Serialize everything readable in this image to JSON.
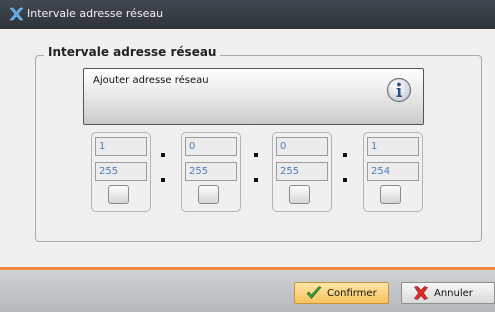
{
  "window": {
    "title": "Intervale adresse réseau",
    "icon": "app-x-icon"
  },
  "group": {
    "legend": "Intervale adresse réseau"
  },
  "info": {
    "text": "Ajouter adresse réseau",
    "icon": "info-icon"
  },
  "octets": [
    {
      "start": "1",
      "end": "255"
    },
    {
      "start": "0",
      "end": "255"
    },
    {
      "start": "0",
      "end": "255"
    },
    {
      "start": "1",
      "end": "254"
    }
  ],
  "buttons": {
    "confirm_label": "Confirmer",
    "cancel_label": "Annuler"
  },
  "colors": {
    "accent_orange": "#f0883c",
    "field_text": "#4a7fbf",
    "titlebar": "#2e333a"
  }
}
